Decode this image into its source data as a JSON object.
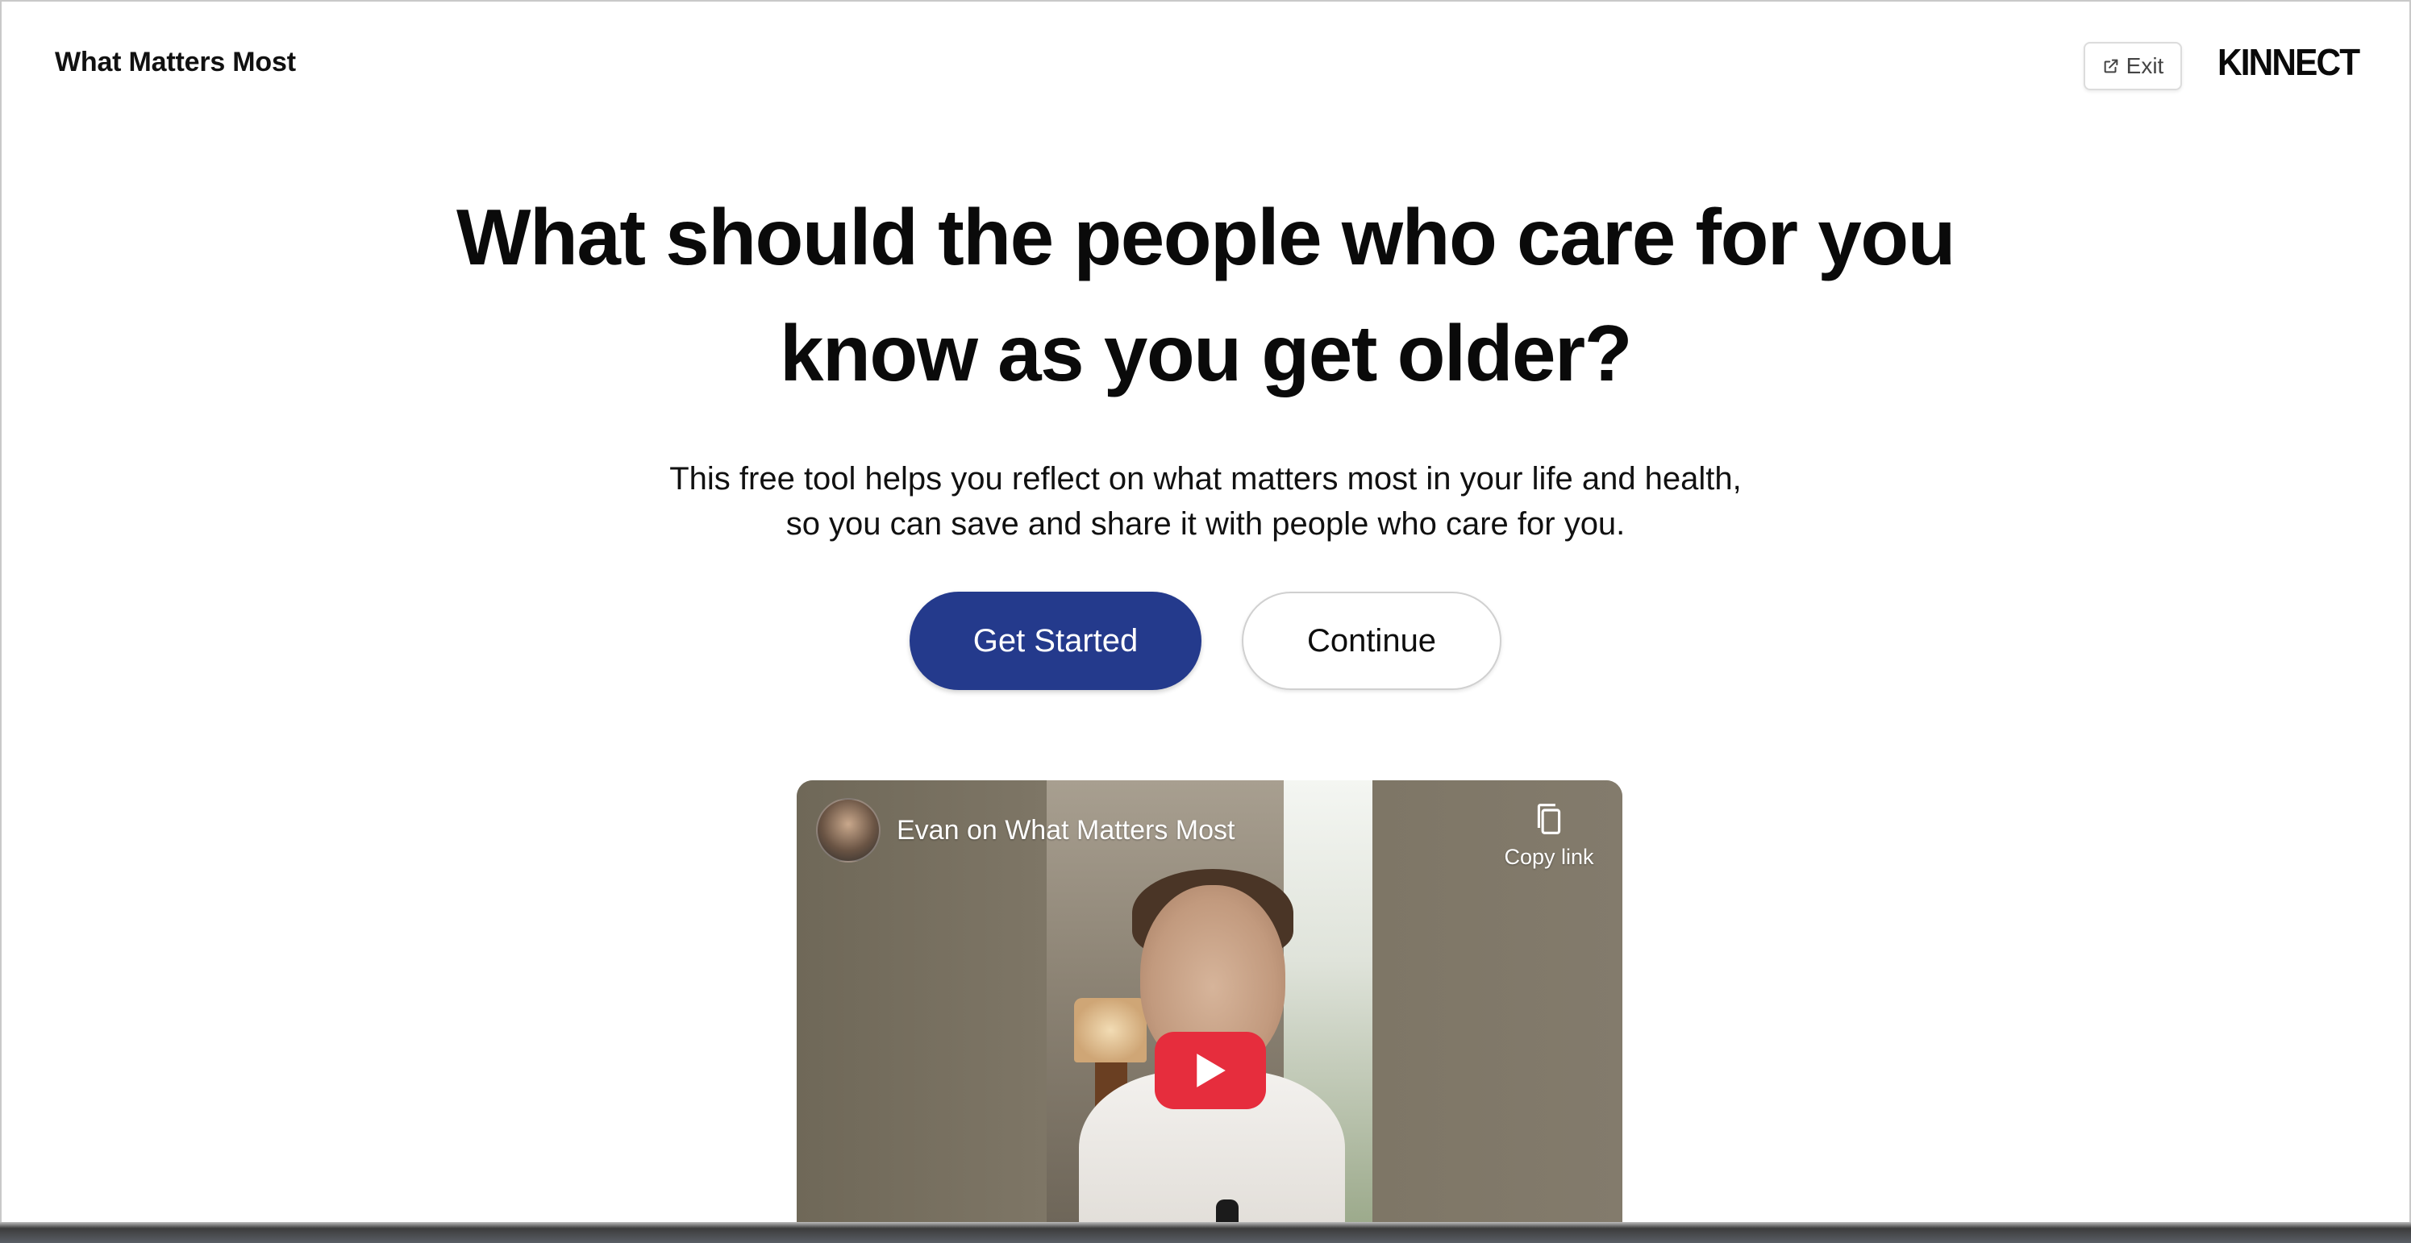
{
  "header": {
    "title": "What Matters Most",
    "exit_label": "Exit",
    "logo_text": "KINNECT"
  },
  "hero": {
    "heading_line1": "What should the people who care for you",
    "heading_line2": "know as you get older?",
    "subtitle_line1": "This free tool helps you reflect on what matters most in your life and health,",
    "subtitle_line2": "so you can save and share it with people who care for you."
  },
  "actions": {
    "primary_label": "Get Started",
    "secondary_label": "Continue"
  },
  "video": {
    "title": "Evan on What Matters Most",
    "copy_link_label": "Copy link",
    "play_icon": "play-icon",
    "copy_icon": "copy-icon"
  },
  "colors": {
    "primary_button": "#243a8c",
    "play_button": "#e62d3d",
    "page_background": "#ffffff"
  }
}
